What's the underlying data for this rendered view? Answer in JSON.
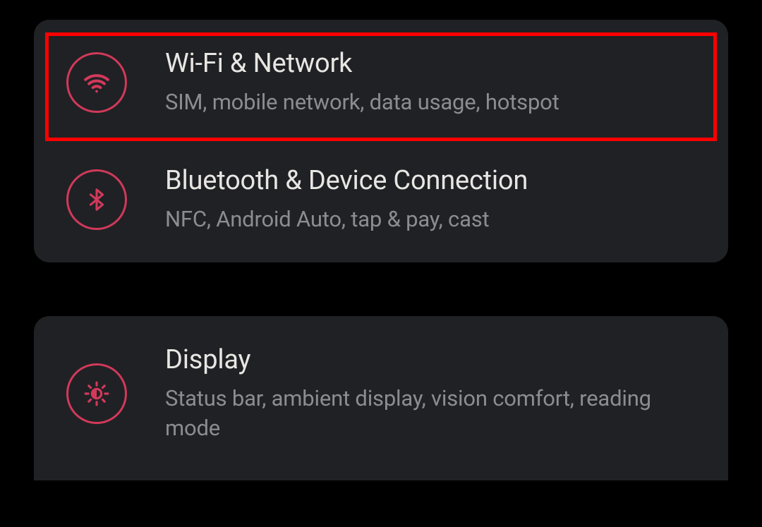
{
  "colors": {
    "accent": "#d1395b",
    "highlight": "#ff0000",
    "cardBg": "#202124",
    "title": "#e8e6e3",
    "subtitle": "#8b8d90"
  },
  "groups": [
    {
      "items": [
        {
          "id": "wifi-network",
          "icon": "wifi-icon",
          "title": "Wi-Fi & Network",
          "subtitle": "SIM, mobile network, data usage, hotspot",
          "highlighted": true
        },
        {
          "id": "bluetooth-device",
          "icon": "bluetooth-icon",
          "title": "Bluetooth & Device Connection",
          "subtitle": "NFC, Android Auto, tap & pay, cast",
          "highlighted": false
        }
      ]
    },
    {
      "items": [
        {
          "id": "display",
          "icon": "brightness-icon",
          "title": "Display",
          "subtitle": "Status bar, ambient display, vision comfort, reading mode",
          "highlighted": false
        }
      ]
    }
  ]
}
